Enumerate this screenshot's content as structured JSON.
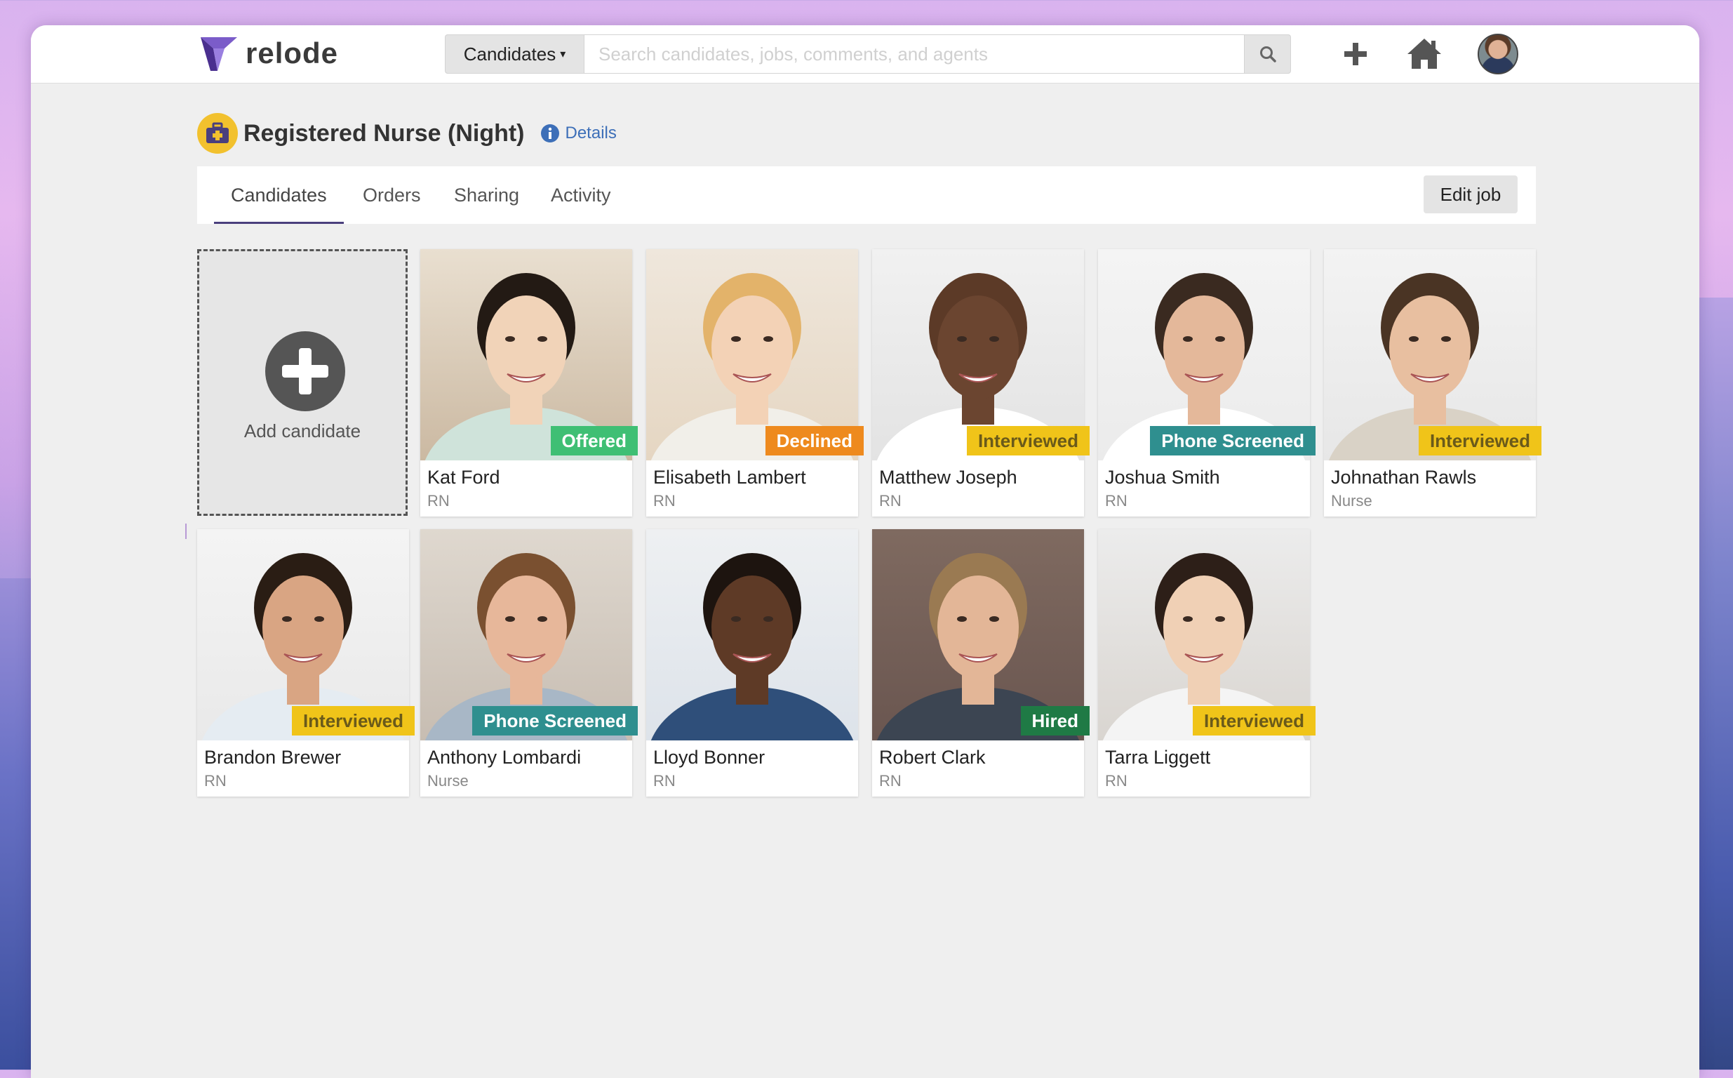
{
  "app": {
    "logo_text": "relode"
  },
  "header": {
    "search_category": "Candidates",
    "search_placeholder": "Search candidates, jobs, comments, and agents"
  },
  "job": {
    "title": "Registered Nurse (Night)",
    "details_label": "Details"
  },
  "tabs": [
    {
      "label": "Candidates",
      "active": true
    },
    {
      "label": "Orders",
      "active": false
    },
    {
      "label": "Sharing",
      "active": false
    },
    {
      "label": "Activity",
      "active": false
    }
  ],
  "edit_job_label": "Edit job",
  "add_candidate_label": "Add candidate",
  "status_colors": {
    "Offered": "#3fbf74",
    "Declined": "#ee8a1e",
    "Interviewed": "#f0c419",
    "Phone Screened": "#2f8f8f",
    "Hired": "#1f7a45"
  },
  "candidates": [
    {
      "name": "Kat Ford",
      "role": "RN",
      "status": "Offered"
    },
    {
      "name": "Elisabeth Lambert",
      "role": "RN",
      "status": "Declined"
    },
    {
      "name": "Matthew Joseph",
      "role": "RN",
      "status": "Interviewed"
    },
    {
      "name": "Joshua Smith",
      "role": "RN",
      "status": "Phone Screened"
    },
    {
      "name": "Johnathan Rawls",
      "role": "Nurse",
      "status": "Interviewed"
    },
    {
      "name": "Brandon Brewer",
      "role": "RN",
      "status": "Interviewed"
    },
    {
      "name": "Anthony Lombardi",
      "role": "Nurse",
      "status": "Phone Screened"
    },
    {
      "name": "Lloyd Bonner",
      "role": "RN",
      "status": ""
    },
    {
      "name": "Robert Clark",
      "role": "RN",
      "status": "Hired"
    },
    {
      "name": "Tarra Liggett",
      "role": "RN",
      "status": "Interviewed"
    }
  ]
}
